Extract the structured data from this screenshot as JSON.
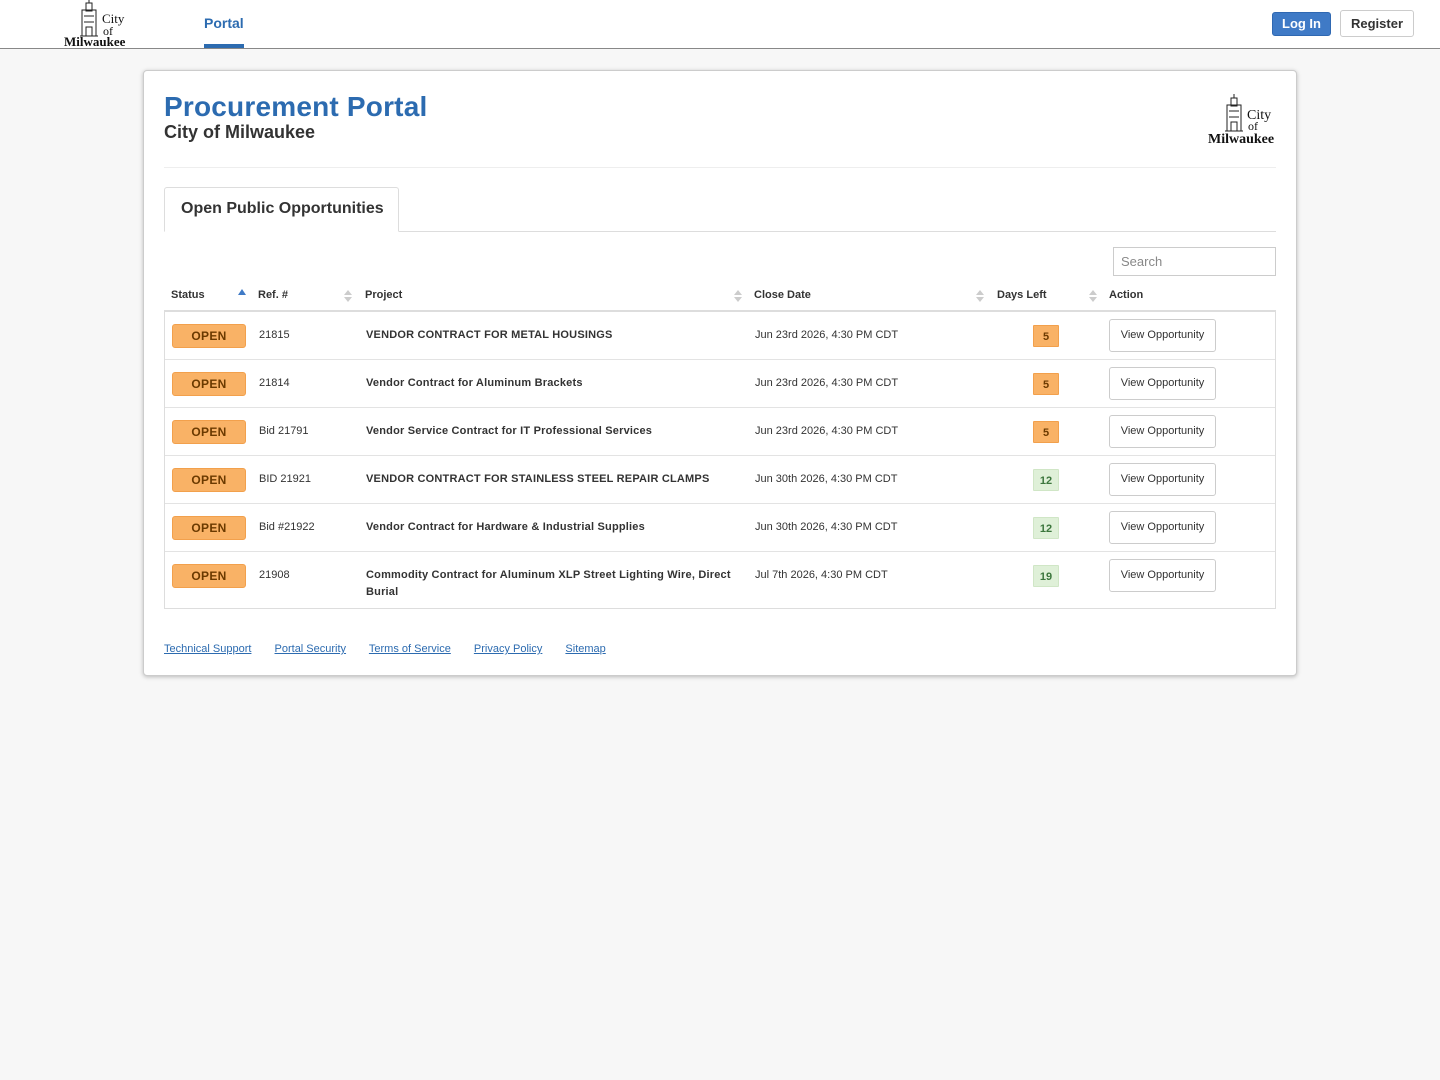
{
  "nav": {
    "logo_text": [
      "City",
      "of",
      "Milwaukee"
    ],
    "tab_portal": "Portal",
    "login_label": "Log In",
    "register_label": "Register"
  },
  "header": {
    "title": "Procurement Portal",
    "subtitle": "City of Milwaukee"
  },
  "tabs": {
    "active": "Open Public Opportunities"
  },
  "search": {
    "placeholder": "Search"
  },
  "table": {
    "columns": [
      "Status",
      "Ref. #",
      "Project",
      "Close Date",
      "Days Left",
      "Action"
    ],
    "sorted_column": "Status",
    "rows": [
      {
        "status": "OPEN",
        "ref": "21815",
        "project": "VENDOR CONTRACT FOR METAL HOUSINGS",
        "close_date": "Jun 23rd 2026, 4:30 PM CDT",
        "days_left": "5",
        "action": "View Opportunity"
      },
      {
        "status": "OPEN",
        "ref": "21814",
        "project": "Vendor Contract for Aluminum Brackets",
        "close_date": "Jun 23rd 2026, 4:30 PM CDT",
        "days_left": "5",
        "action": "View Opportunity"
      },
      {
        "status": "OPEN",
        "ref": "Bid 21791",
        "project": "Vendor Service Contract for IT Professional Services",
        "close_date": "Jun 23rd 2026, 4:30 PM CDT",
        "days_left": "5",
        "action": "View Opportunity"
      },
      {
        "status": "OPEN",
        "ref": "BID 21921",
        "project": "VENDOR CONTRACT FOR STAINLESS STEEL REPAIR CLAMPS",
        "close_date": "Jun 30th 2026, 4:30 PM CDT",
        "days_left": "12",
        "action": "View Opportunity"
      },
      {
        "status": "OPEN",
        "ref": "Bid #21922",
        "project": "Vendor Contract for Hardware & Industrial Supplies",
        "close_date": "Jun 30th 2026, 4:30 PM CDT",
        "days_left": "12",
        "action": "View Opportunity"
      },
      {
        "status": "OPEN",
        "ref": "21908",
        "project": "Commodity Contract for Aluminum XLP Street Lighting Wire, Direct Burial",
        "close_date": "Jul 7th 2026, 4:30 PM CDT",
        "days_left": "19",
        "action": "View Opportunity"
      }
    ]
  },
  "footer": {
    "links": [
      "Technical Support",
      "Portal Security",
      "Terms of Service",
      "Privacy Policy",
      "Sitemap"
    ]
  },
  "colors": {
    "accent": "#2c6bb0",
    "open_badge": "#f9b266",
    "days_warning": "#f9b266",
    "days_ok": "#dff0d8"
  }
}
